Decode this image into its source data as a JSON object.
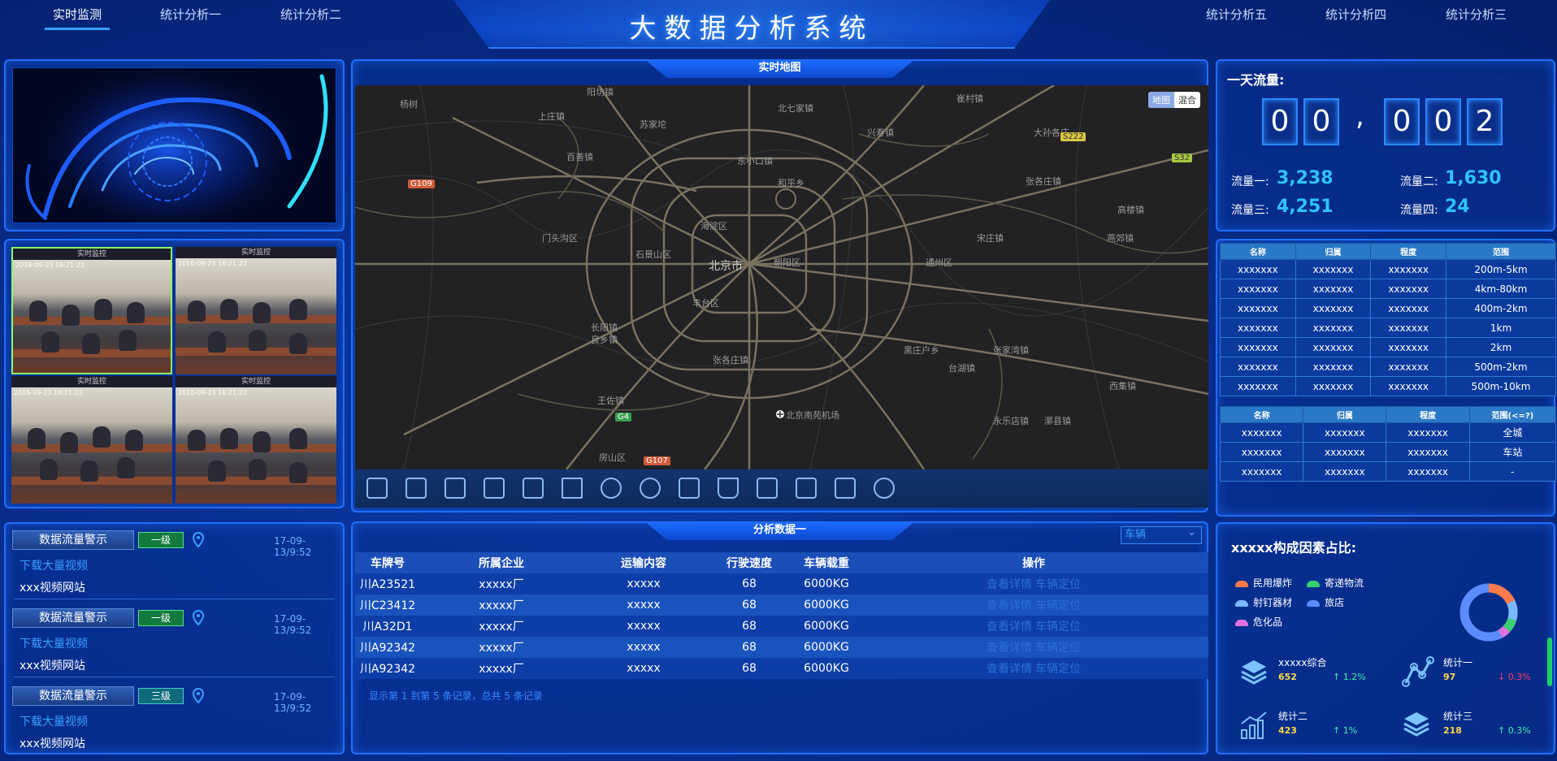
{
  "header": {
    "title": "大数据分析系统",
    "nav_left": [
      "实时监测",
      "统计分析一",
      "统计分析二"
    ],
    "nav_right": [
      "统计分析五",
      "统计分析四",
      "统计分析三"
    ]
  },
  "cameras": {
    "header": "实时监控",
    "timestamp": "2016-09-23 16:21:22"
  },
  "alerts": [
    {
      "button": "数据流量警示",
      "level": "一级",
      "time": "17-09-13/9:52",
      "link": "下载大量视频",
      "text": "xxx视频网站"
    },
    {
      "button": "数据流量警示",
      "level": "一级",
      "time": "17-09-13/9:52",
      "link": "下载大量视频",
      "text": "xxx视频网站"
    },
    {
      "button": "数据流量警示",
      "level": "三级",
      "time": "17-09-13/9:52",
      "link": "下载大量视频",
      "text": "xxx视频网站"
    }
  ],
  "map": {
    "title": "实时地图",
    "type_map": "地图",
    "type_mixed": "混合",
    "roads": [
      "G109",
      "S222",
      "S32",
      "G4",
      "G107"
    ],
    "places": [
      "杨树",
      "阳坊镇",
      "北七家镇",
      "崔村镇",
      "木林镇",
      "上庄镇",
      "苏家坨",
      "温泉镇",
      "百善镇",
      "燕丹乡",
      "兴寿镇",
      "李遂镇",
      "大孙各庄",
      "马池口镇",
      "小汤山镇",
      "南邵镇",
      "东小口镇",
      "和平乡",
      "张各庄镇",
      "西红门",
      "北京市",
      "石景山区",
      "丰台区",
      "朝阳区",
      "海淀区",
      "通州区",
      "大兴区",
      "房山区",
      "门头沟区",
      "北京南苑机场",
      "王佐镇",
      "长阳镇",
      "良乡镇",
      "宋庄镇",
      "台湖镇",
      "黑庄户乡",
      "张家湾镇",
      "永乐店镇",
      "潞城镇",
      "高楼镇",
      "燕郊镇",
      "西集镇",
      "漷县镇",
      "大兴区"
    ]
  },
  "analysis": {
    "title": "分析数据一",
    "select": "车辆",
    "columns": [
      "车牌号",
      "所属企业",
      "运输内容",
      "行驶速度",
      "车辆载重",
      "操作"
    ],
    "rows": [
      [
        "川A23521",
        "xxxxx厂",
        "xxxxx",
        "68",
        "6000KG"
      ],
      [
        "川C23412",
        "xxxxx厂",
        "xxxxx",
        "68",
        "6000KG"
      ],
      [
        "川A32D1",
        "xxxxx厂",
        "xxxxx",
        "68",
        "6000KG"
      ],
      [
        "川A92342",
        "xxxxx厂",
        "xxxxx",
        "68",
        "6000KG"
      ],
      [
        "川A92342",
        "xxxxx厂",
        "xxxxx",
        "68",
        "6000KG"
      ]
    ],
    "op_detail": "查看详情",
    "op_locate": "车辆定位",
    "pager": "显示第 1 到第 5 条记录，总共 5 条记录"
  },
  "flow": {
    "title": "一天流量:",
    "digits": [
      "0",
      "0",
      ",",
      "0",
      "0",
      "2"
    ],
    "items": [
      {
        "label": "流量一:",
        "value": "3,238"
      },
      {
        "label": "流量二:",
        "value": "1,630"
      },
      {
        "label": "流量三:",
        "value": "4,251"
      },
      {
        "label": "流量四:",
        "value": "24"
      }
    ]
  },
  "range_table": {
    "columns": [
      "名称",
      "归属",
      "程度",
      "范围"
    ],
    "rows": [
      [
        "xxxxxxx",
        "xxxxxxx",
        "xxxxxxx",
        "200m-5km"
      ],
      [
        "xxxxxxx",
        "xxxxxxx",
        "xxxxxxx",
        "4km-80km"
      ],
      [
        "xxxxxxx",
        "xxxxxxx",
        "xxxxxxx",
        "400m-2km"
      ],
      [
        "xxxxxxx",
        "xxxxxxx",
        "xxxxxxx",
        "1km"
      ],
      [
        "xxxxxxx",
        "xxxxxxx",
        "xxxxxxx",
        "2km"
      ],
      [
        "xxxxxxx",
        "xxxxxxx",
        "xxxxxxx",
        "500m-2km"
      ],
      [
        "xxxxxxx",
        "xxxxxxx",
        "xxxxxxx",
        "500m-10km"
      ]
    ]
  },
  "scope_table": {
    "columns": [
      "名称",
      "归属",
      "程度",
      "范围(<=?)"
    ],
    "rows": [
      [
        "xxxxxxx",
        "xxxxxxx",
        "xxxxxxx",
        "全城"
      ],
      [
        "xxxxxxx",
        "xxxxxxx",
        "xxxxxxx",
        "车站"
      ],
      [
        "xxxxxxx",
        "xxxxxxx",
        "xxxxxxx",
        "-"
      ]
    ]
  },
  "composition": {
    "title": "xxxxx构成因素占比:",
    "legend": [
      {
        "label": "民用爆炸",
        "color": "#ff7a4a"
      },
      {
        "label": "寄递物流",
        "color": "#3ad070"
      },
      {
        "label": "射钉器材",
        "color": "#7ab8ff"
      },
      {
        "label": "旅店",
        "color": "#5a8cff"
      },
      {
        "label": "危化品",
        "color": "#e070e0"
      }
    ],
    "stats": [
      {
        "title": "xxxxx综合",
        "value": "652",
        "change": "↑ 1.2%",
        "dir": "up",
        "icon": "layers-icon"
      },
      {
        "title": "统计一",
        "value": "97",
        "change": "↓ 0.3%",
        "dir": "down",
        "icon": "line-nodes-icon"
      },
      {
        "title": "统计二",
        "value": "423",
        "change": "↑ 1%",
        "dir": "up",
        "icon": "bar-trend-icon"
      },
      {
        "title": "统计三",
        "value": "218",
        "change": "↑ 0.3%",
        "dir": "up",
        "icon": "layers-icon"
      }
    ]
  }
}
